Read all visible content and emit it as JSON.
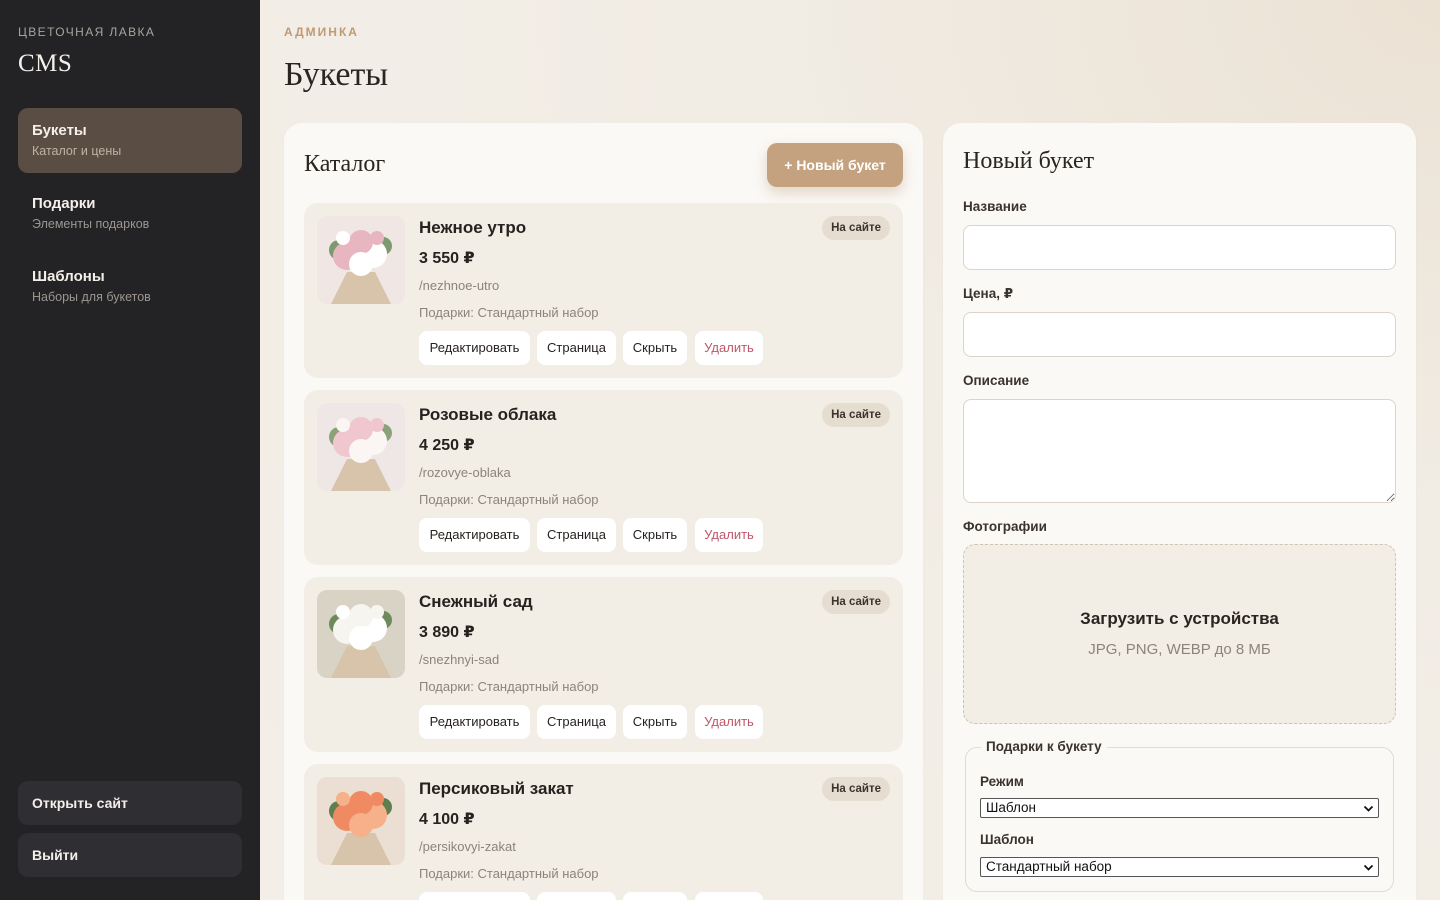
{
  "sidebar": {
    "brand_sub": "ЦВЕТОЧНАЯ ЛАВКА",
    "brand_title": "CMS",
    "items": [
      {
        "label": "Букеты",
        "sub": "Каталог и цены",
        "active": true
      },
      {
        "label": "Подарки",
        "sub": "Элементы подарков",
        "active": false
      },
      {
        "label": "Шаблоны",
        "sub": "Наборы для букетов",
        "active": false
      }
    ],
    "open_site": "Открыть сайт",
    "logout": "Выйти"
  },
  "header": {
    "kicker": "АДМИНКА",
    "title": "Букеты"
  },
  "catalog": {
    "title": "Каталог",
    "new_button": "+ Новый букет",
    "actions": {
      "edit": "Редактировать",
      "page": "Страница",
      "hide": "Скрыть",
      "delete": "Удалить"
    },
    "items": [
      {
        "name": "Нежное утро",
        "price": "3 550 ₽",
        "slug": "/nezhnoe-utro",
        "gifts": "Подарки: Стандартный набор",
        "status": "На сайте",
        "palette": [
          "#f0e6e4",
          "#e8b6c0",
          "#ffffff",
          "#7c9a6e"
        ]
      },
      {
        "name": "Розовые облака",
        "price": "4 250 ₽",
        "slug": "/rozovye-oblaka",
        "gifts": "Подарки: Стандартный набор",
        "status": "На сайте",
        "palette": [
          "#efe7e6",
          "#f0c6cf",
          "#fbf6f3",
          "#8aa27a"
        ]
      },
      {
        "name": "Снежный сад",
        "price": "3 890 ₽",
        "slug": "/snezhnyi-sad",
        "gifts": "Подарки: Стандартный набор",
        "status": "На сайте",
        "palette": [
          "#d9d3c6",
          "#f7f5ef",
          "#ffffff",
          "#6d8a5c"
        ]
      },
      {
        "name": "Персиковый закат",
        "price": "4 100 ₽",
        "slug": "/persikovyi-zakat",
        "gifts": "Подарки: Стандартный набор",
        "status": "На сайте",
        "palette": [
          "#eadfd2",
          "#f08a62",
          "#f6b08a",
          "#5f7d4d"
        ]
      }
    ]
  },
  "form": {
    "title": "Новый букет",
    "name_label": "Название",
    "price_label": "Цена, ₽",
    "description_label": "Описание",
    "photos_label": "Фотографии",
    "upload_title": "Загрузить с устройства",
    "upload_hint": "JPG, PNG, WEBP до 8 МБ",
    "gifts_legend": "Подарки к букету",
    "mode_label": "Режим",
    "mode_value": "Шаблон",
    "template_label": "Шаблон",
    "template_value": "Стандартный набор"
  }
}
